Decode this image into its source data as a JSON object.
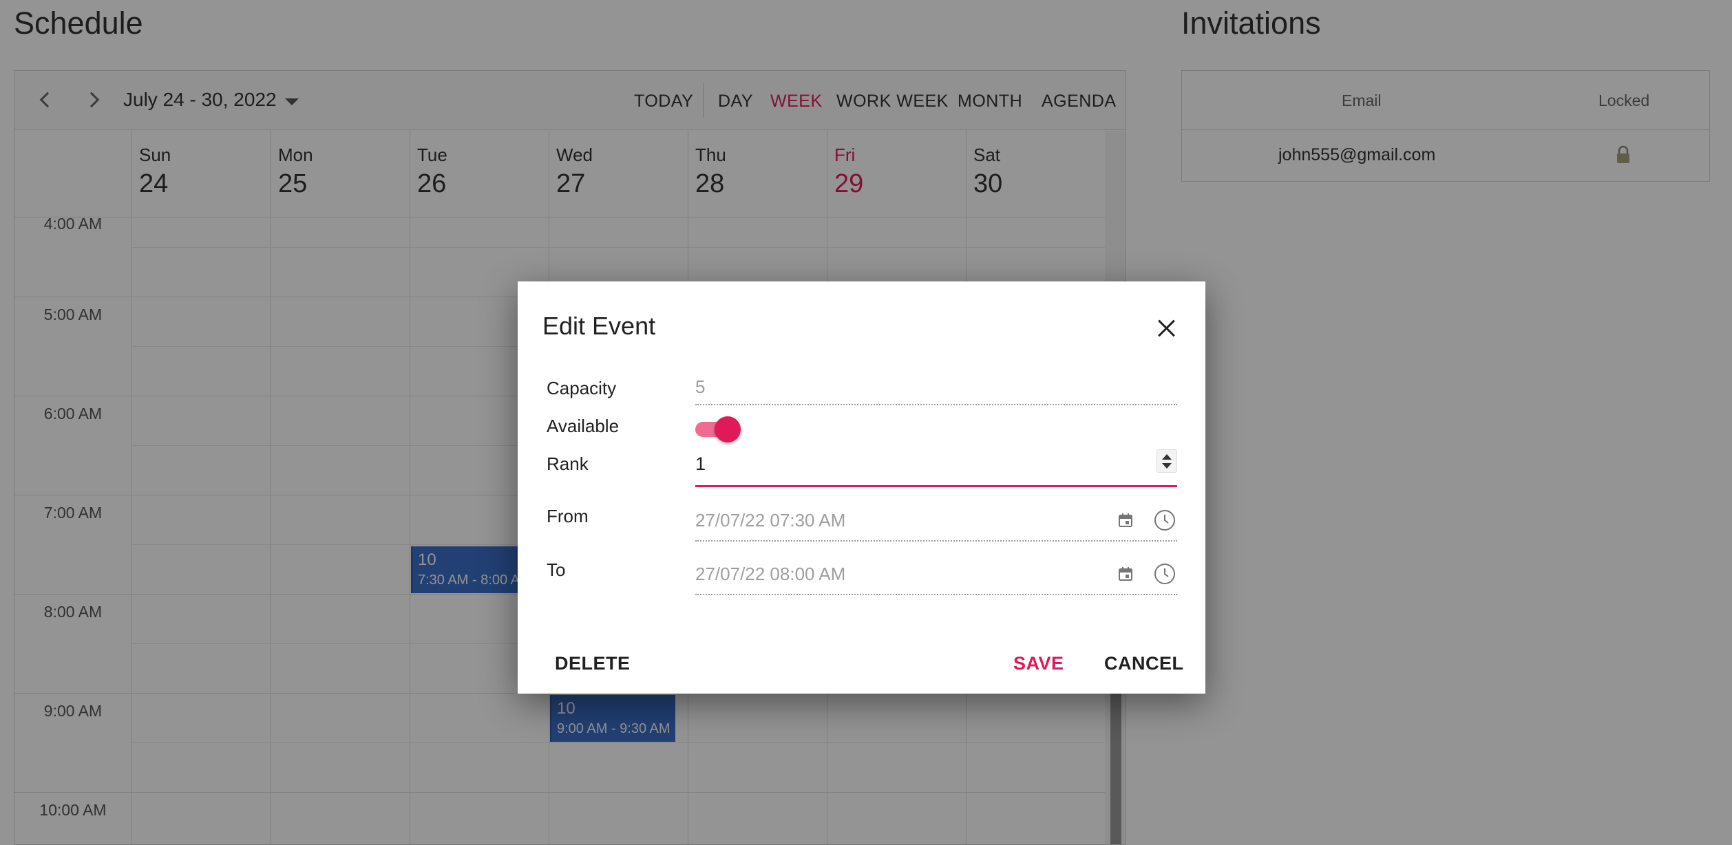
{
  "page": {
    "schedule_title": "Schedule",
    "invitations_title": "Invitations"
  },
  "scheduler": {
    "date_range": "July 24 - 30, 2022",
    "views": [
      {
        "label": "TODAY"
      },
      {
        "label": "DAY"
      },
      {
        "label": "WEEK",
        "active": true
      },
      {
        "label": "WORK WEEK"
      },
      {
        "label": "MONTH"
      },
      {
        "label": "AGENDA"
      }
    ],
    "days": [
      {
        "name": "Sun",
        "num": "24"
      },
      {
        "name": "Mon",
        "num": "25"
      },
      {
        "name": "Tue",
        "num": "26"
      },
      {
        "name": "Wed",
        "num": "27"
      },
      {
        "name": "Thu",
        "num": "28"
      },
      {
        "name": "Fri",
        "num": "29",
        "today": true
      },
      {
        "name": "Sat",
        "num": "30"
      }
    ],
    "time_slots": [
      "4:00 AM",
      "5:00 AM",
      "6:00 AM",
      "7:00 AM",
      "8:00 AM",
      "9:00 AM",
      "10:00 AM"
    ],
    "appointments": [
      {
        "title": "10",
        "time": "7:30 AM - 8:00 AM",
        "day": "Tue"
      },
      {
        "title": "10",
        "time": "9:00 AM - 9:30 AM",
        "day": "Wed"
      }
    ],
    "today_color": "#e01a59",
    "appointment_color": "#3b6fc9"
  },
  "invitations": {
    "columns": {
      "email": "Email",
      "locked": "Locked"
    },
    "rows": [
      {
        "email": "john555@gmail.com",
        "locked": true,
        "locked_icon": "lock-icon"
      }
    ]
  },
  "dialog": {
    "title": "Edit Event",
    "close_icon": "close-icon",
    "capacity": {
      "label": "Capacity",
      "value": "5"
    },
    "available": {
      "label": "Available",
      "checked": true
    },
    "rank": {
      "label": "Rank",
      "value": "1"
    },
    "from": {
      "label": "From",
      "value": "27/07/22 07:30 AM"
    },
    "to": {
      "label": "To",
      "value": "27/07/22 08:00 AM"
    },
    "buttons": {
      "delete": "DELETE",
      "save": "SAVE",
      "cancel": "CANCEL"
    },
    "accent_color": "#e01a59"
  }
}
